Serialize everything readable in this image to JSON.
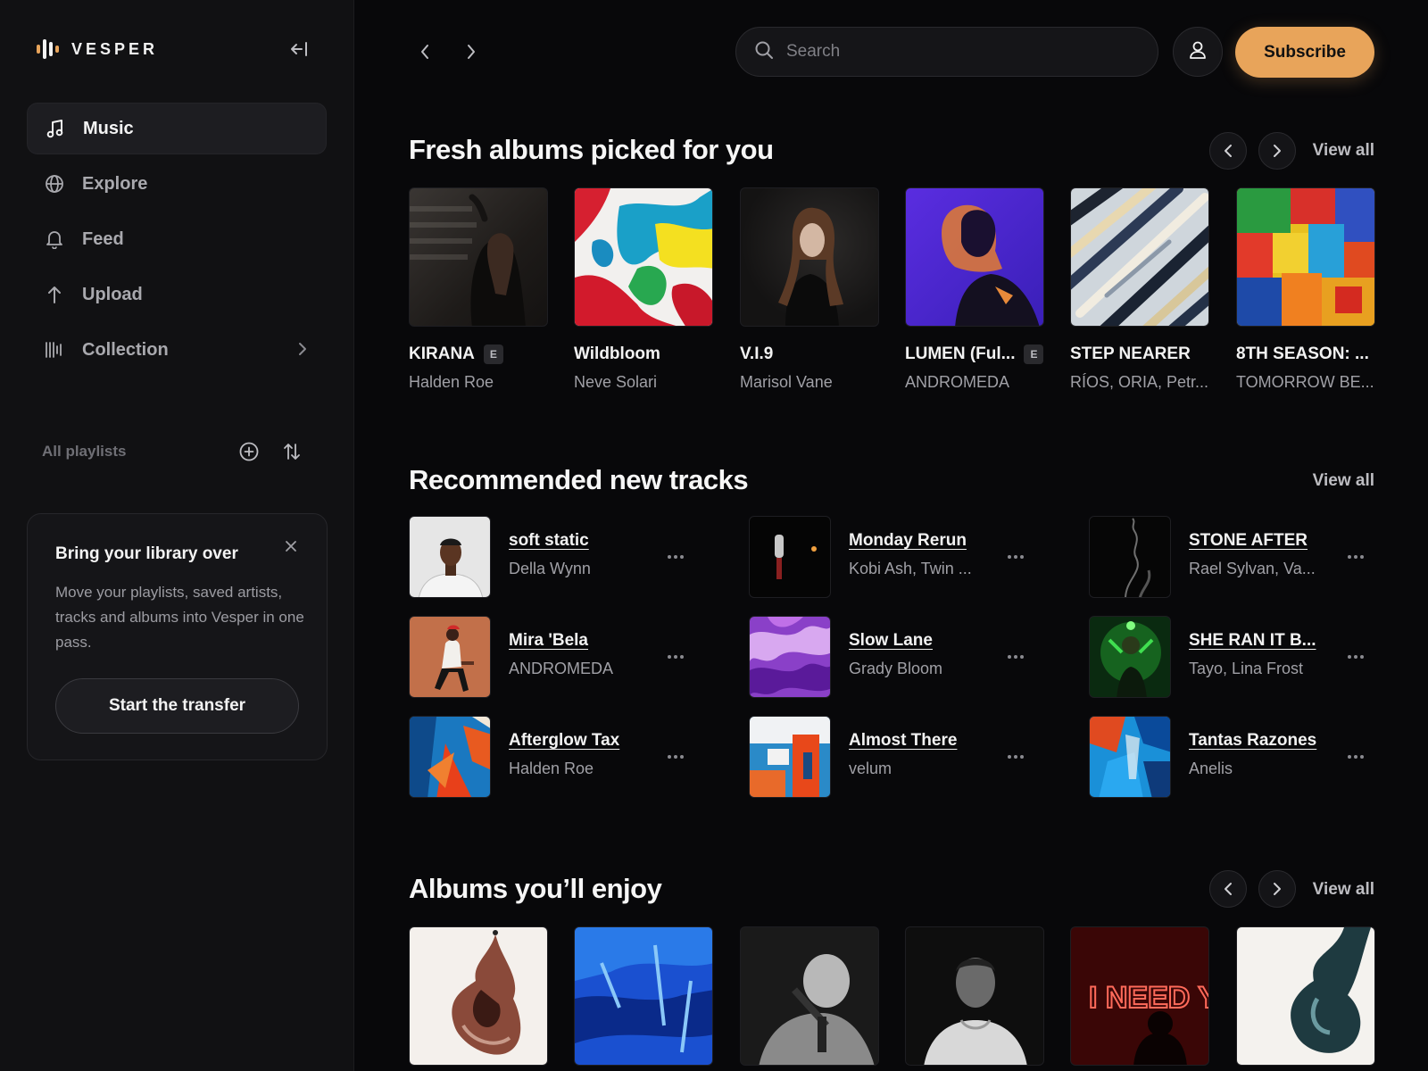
{
  "brand": {
    "name": "VESPER"
  },
  "sidebar": {
    "nav": [
      {
        "label": "Music",
        "icon": "music-note-icon",
        "active": true
      },
      {
        "label": "Explore",
        "icon": "globe-icon",
        "active": false
      },
      {
        "label": "Feed",
        "icon": "bell-icon",
        "active": false
      },
      {
        "label": "Upload",
        "icon": "arrow-up-icon",
        "active": false
      },
      {
        "label": "Collection",
        "icon": "library-icon",
        "active": false
      }
    ],
    "playlists_label": "All playlists",
    "promo": {
      "title": "Bring your library over",
      "body": "Move your playlists, saved artists, tracks and albums into Vesper in one pass.",
      "button": "Start the transfer"
    }
  },
  "topbar": {
    "search_placeholder": "Search",
    "subscribe_label": "Subscribe"
  },
  "colors": {
    "accent": "#e8a45a",
    "background": "#08080a",
    "sidebar": "#111113"
  },
  "sections": {
    "fresh": {
      "title": "Fresh albums picked for you",
      "view_all": "View all",
      "albums": [
        {
          "title": "KIRANA",
          "artist": "Halden Roe",
          "explicit": "E"
        },
        {
          "title": "Wildbloom",
          "artist": "Neve Solari",
          "explicit": ""
        },
        {
          "title": "V.I.9",
          "artist": "Marisol Vane",
          "explicit": ""
        },
        {
          "title": "LUMEN (Ful...",
          "artist": "ANDROMEDA",
          "explicit": "E"
        },
        {
          "title": "STEP NEARER",
          "artist": "RÍOS, ORIA, Petr...",
          "explicit": ""
        },
        {
          "title": "8TH SEASON: ...",
          "artist": "TOMORROW BE...",
          "explicit": ""
        }
      ]
    },
    "tracks": {
      "title": "Recommended new tracks",
      "view_all": "View all",
      "items": [
        {
          "title": "soft static",
          "artist": "Della Wynn"
        },
        {
          "title": "Monday Rerun",
          "artist": "Kobi Ash, Twin ..."
        },
        {
          "title": "STONE AFTER",
          "artist": "Rael Sylvan, Va..."
        },
        {
          "title": "Mira 'Bela",
          "artist": "ANDROMEDA"
        },
        {
          "title": "Slow Lane",
          "artist": "Grady Bloom"
        },
        {
          "title": "SHE RAN IT B...",
          "artist": "Tayo, Lina Frost"
        },
        {
          "title": "Afterglow Tax",
          "artist": "Halden Roe"
        },
        {
          "title": "Almost There",
          "artist": "velum"
        },
        {
          "title": "Tantas Razones",
          "artist": "Anelis"
        }
      ]
    },
    "enjoy": {
      "title": "Albums you’ll enjoy",
      "view_all": "View all",
      "cover_text": "I NEED YOU"
    }
  }
}
